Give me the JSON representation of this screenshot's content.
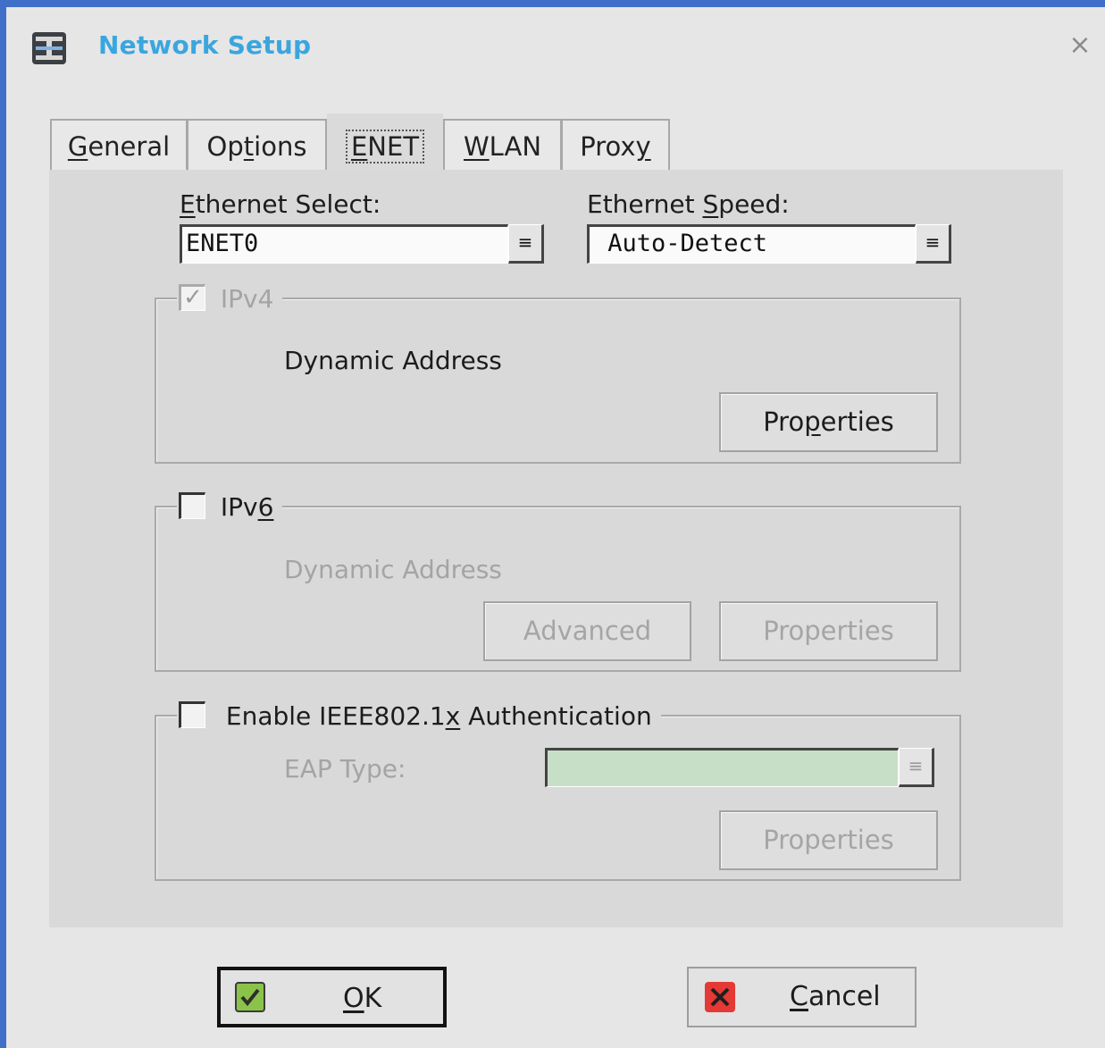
{
  "window": {
    "title": "Network Setup",
    "close_glyph": "×",
    "accent_color": "#3f6fc8",
    "title_color": "#3aa6df"
  },
  "tabs": [
    {
      "label": "General",
      "underline": "G",
      "rest": "eneral",
      "active": false
    },
    {
      "label": "Options",
      "pre": "Op",
      "underline": "t",
      "rest": "ions",
      "active": false
    },
    {
      "label": "ENET",
      "underline": "E",
      "rest": "NET",
      "active": true
    },
    {
      "label": "WLAN",
      "underline": "W",
      "rest": "LAN",
      "active": false
    },
    {
      "label": "Proxy",
      "pre": "Prox",
      "underline": "y",
      "rest": "",
      "active": false
    }
  ],
  "ethernet_select": {
    "label_u": "E",
    "label_rest": "thernet Select:",
    "value": "ENET0",
    "drop_glyph": "≡"
  },
  "ethernet_speed": {
    "label_pre": "Ethernet ",
    "label_u": "S",
    "label_rest": "peed:",
    "value": " Auto-Detect",
    "drop_glyph": "≡"
  },
  "ipv4": {
    "label": "IPv4",
    "checked": true,
    "enabled": false,
    "check_glyph": "✓",
    "mode": "Dynamic Address",
    "properties": {
      "pre": "Pro",
      "underline": "p",
      "rest": "erties"
    }
  },
  "ipv6": {
    "label_pre": "IPv",
    "label_u": "6",
    "checked": false,
    "mode": "Dynamic Address",
    "advanced": "Advanced",
    "properties": "Properties"
  },
  "ieee8021x": {
    "label_pre": "Enable IEEE802.1",
    "label_u": "x",
    "label_rest": " Authentication",
    "checked": false,
    "eap_label": "EAP Type:",
    "eap_value": "",
    "eap_field_color": "#c7dfc7",
    "drop_glyph": "≡",
    "properties": "Properties"
  },
  "footer": {
    "ok": {
      "underline": "O",
      "rest": "K",
      "icon": "check-icon",
      "icon_color": "#8bc34a"
    },
    "cancel": {
      "underline": "C",
      "rest": "ancel",
      "icon": "x-icon",
      "icon_color": "#e53935"
    }
  }
}
